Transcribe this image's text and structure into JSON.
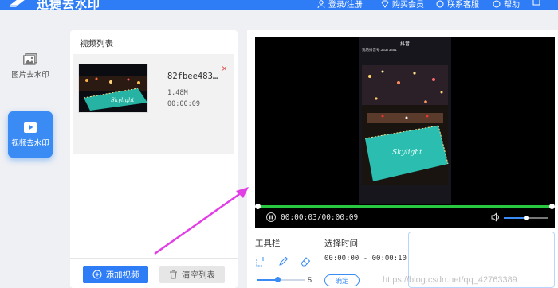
{
  "app": {
    "title": "迅捷去水印"
  },
  "nav": {
    "login": "登录/注册",
    "buy": "购买会员",
    "service": "联系客服",
    "help": "帮助"
  },
  "rail": {
    "items": [
      {
        "label": "图片去水印",
        "icon": "image-icon"
      },
      {
        "label": "视频去水印",
        "icon": "play-icon"
      }
    ]
  },
  "list": {
    "title": "视频列表",
    "items": [
      {
        "name": "82fbee483…",
        "size": "1.48M",
        "duration": "00:00:09"
      }
    ],
    "add_button": "添加视频",
    "clear_button": "清空列表"
  },
  "player": {
    "timecode": "00:00:03/00:00:09",
    "tiktok_label": "抖音",
    "tiktok_id": "我的抖音号:33373851",
    "volume": 0.5
  },
  "tools": {
    "title": "工具栏",
    "brush_size": "5"
  },
  "time_select": {
    "title": "选择时间",
    "range": "00:00:00 - 00:00:10",
    "confirm": "确定"
  },
  "watermark": "https://blog.csdn.net/qq_42763389",
  "colors": {
    "accent": "#2f7df6",
    "progress": "#28c940",
    "arrow": "#e23ee6",
    "delete": "#e54545"
  }
}
